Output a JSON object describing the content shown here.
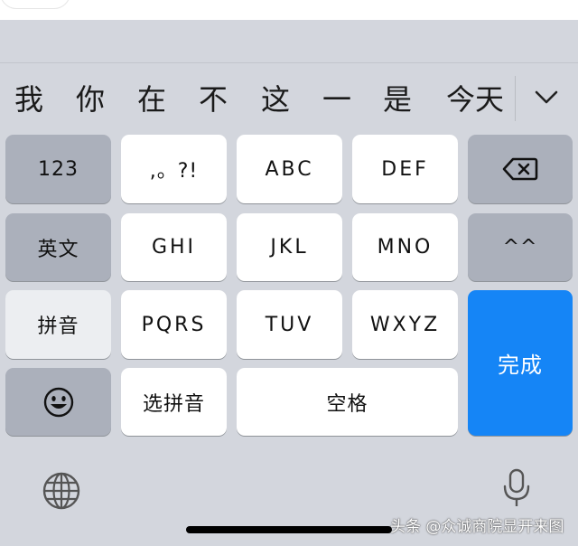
{
  "candidates": [
    "我",
    "你",
    "在",
    "不",
    "这",
    "一",
    "是",
    "今天"
  ],
  "keys": {
    "num": "123",
    "punct": ",。?!",
    "abc": "ABC",
    "def": "DEF",
    "english": "英文",
    "ghi": "GHI",
    "jkl": "JKL",
    "mno": "MNO",
    "emoticon": "^^",
    "pinyin": "拼音",
    "pqrs": "PQRS",
    "tuv": "TUV",
    "wxyz": "WXYZ",
    "done": "完成",
    "select_pinyin": "选拼音",
    "space": "空格"
  },
  "icons": {
    "backspace": "backspace-icon",
    "emoji": "emoji-icon",
    "globe": "globe-icon",
    "mic": "microphone-icon",
    "collapse": "chevron-down-icon"
  },
  "watermark": "头条 @众诚商院显开来图",
  "colors": {
    "accent": "#1585f6",
    "keyboard_bg": "#d3d6dd",
    "function_key": "#abb0bb"
  }
}
